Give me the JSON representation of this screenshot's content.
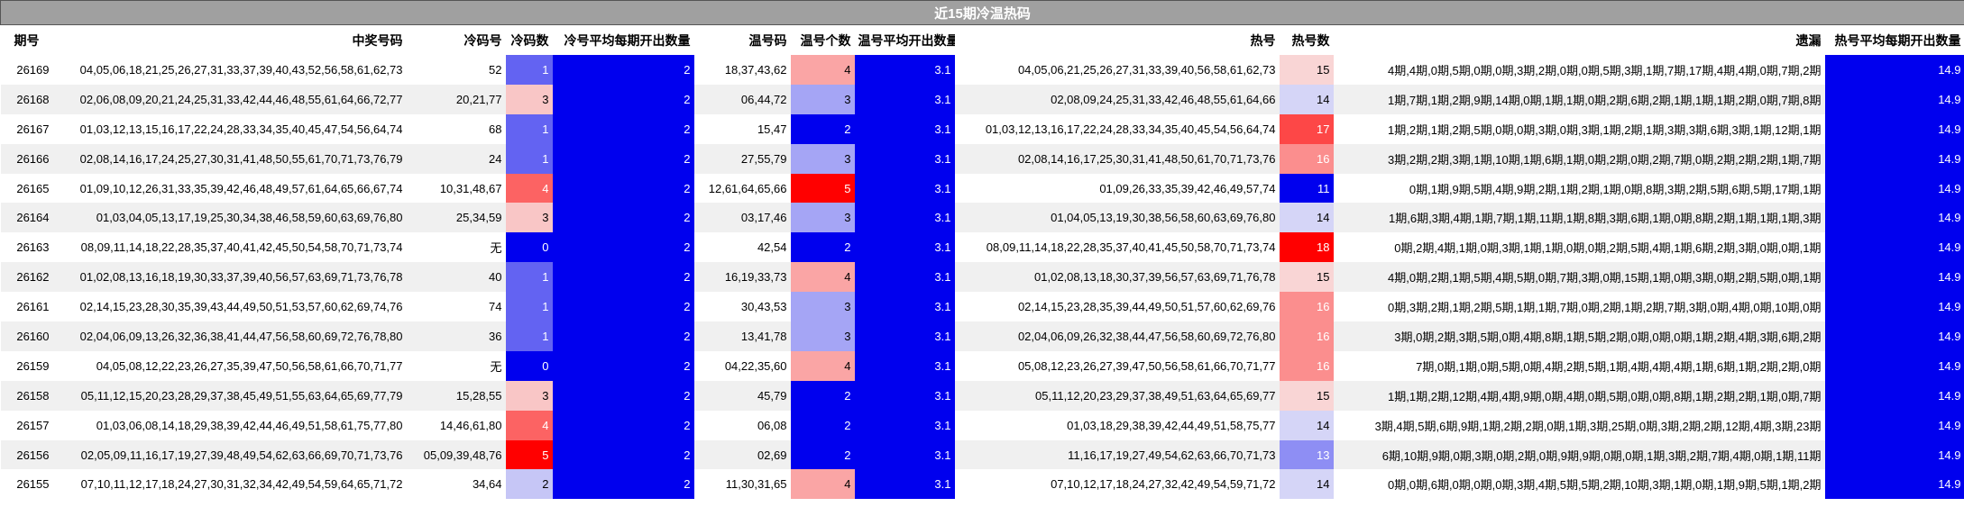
{
  "title": "近15期冷温热码",
  "columns": [
    "期号",
    "中奖号码",
    "冷码号",
    "冷码数",
    "冷号平均每期开出数量",
    "温号码",
    "温号个数",
    "温号平均开出数量",
    "热号",
    "热号数",
    "遗漏",
    "热号平均每期开出数量"
  ],
  "rows": [
    {
      "period": "26169",
      "numbers": "04,05,06,18,21,25,26,27,31,33,37,39,40,43,52,56,58,61,62,73",
      "cold": "52",
      "cold_count": "1",
      "cold_avg": "2",
      "warm": "18,37,43,62",
      "warm_count": "4",
      "warm_avg": "3.1",
      "hot": "04,05,06,21,25,26,27,31,33,39,40,56,58,61,62,73",
      "hot_count": "15",
      "miss": "4期,4期,0期,5期,0期,0期,3期,2期,0期,0期,5期,3期,1期,7期,17期,4期,4期,0期,7期,2期",
      "hot_avg": "14.9"
    },
    {
      "period": "26168",
      "numbers": "02,06,08,09,20,21,24,25,31,33,42,44,46,48,55,61,64,66,72,77",
      "cold": "20,21,77",
      "cold_count": "3",
      "cold_avg": "2",
      "warm": "06,44,72",
      "warm_count": "3",
      "warm_avg": "3.1",
      "hot": "02,08,09,24,25,31,33,42,46,48,55,61,64,66",
      "hot_count": "14",
      "miss": "1期,7期,1期,2期,9期,14期,0期,1期,1期,0期,2期,6期,2期,1期,1期,1期,2期,0期,7期,8期",
      "hot_avg": "14.9"
    },
    {
      "period": "26167",
      "numbers": "01,03,12,13,15,16,17,22,24,28,33,34,35,40,45,47,54,56,64,74",
      "cold": "68",
      "cold_count": "1",
      "cold_avg": "2",
      "warm": "15,47",
      "warm_count": "2",
      "warm_avg": "3.1",
      "hot": "01,03,12,13,16,17,22,24,28,33,34,35,40,45,54,56,64,74",
      "hot_count": "17",
      "miss": "1期,2期,1期,2期,5期,0期,0期,3期,0期,3期,1期,2期,1期,3期,3期,6期,3期,1期,12期,1期",
      "hot_avg": "14.9"
    },
    {
      "period": "26166",
      "numbers": "02,08,14,16,17,24,25,27,30,31,41,48,50,55,61,70,71,73,76,79",
      "cold": "24",
      "cold_count": "1",
      "cold_avg": "2",
      "warm": "27,55,79",
      "warm_count": "3",
      "warm_avg": "3.1",
      "hot": "02,08,14,16,17,25,30,31,41,48,50,61,70,71,73,76",
      "hot_count": "16",
      "miss": "3期,2期,2期,3期,1期,10期,1期,6期,1期,0期,2期,0期,2期,7期,0期,2期,2期,2期,1期,7期",
      "hot_avg": "14.9"
    },
    {
      "period": "26165",
      "numbers": "01,09,10,12,26,31,33,35,39,42,46,48,49,57,61,64,65,66,67,74",
      "cold": "10,31,48,67",
      "cold_count": "4",
      "cold_avg": "2",
      "warm": "12,61,64,65,66",
      "warm_count": "5",
      "warm_avg": "3.1",
      "hot": "01,09,26,33,35,39,42,46,49,57,74",
      "hot_count": "11",
      "miss": "0期,1期,9期,5期,4期,9期,2期,1期,2期,1期,0期,8期,3期,2期,5期,6期,5期,17期,1期",
      "hot_avg": "14.9"
    },
    {
      "period": "26164",
      "numbers": "01,03,04,05,13,17,19,25,30,34,38,46,58,59,60,63,69,76,80",
      "cold": "25,34,59",
      "cold_count": "3",
      "cold_avg": "2",
      "warm": "03,17,46",
      "warm_count": "3",
      "warm_avg": "3.1",
      "hot": "01,04,05,13,19,30,38,56,58,60,63,69,76,80",
      "hot_count": "14",
      "miss": "1期,6期,3期,4期,1期,7期,1期,11期,1期,8期,3期,6期,1期,0期,8期,2期,1期,1期,1期,3期",
      "hot_avg": "14.9"
    },
    {
      "period": "26163",
      "numbers": "08,09,11,14,18,22,28,35,37,40,41,42,45,50,54,58,70,71,73,74",
      "cold": "无",
      "cold_count": "0",
      "cold_avg": "2",
      "warm": "42,54",
      "warm_count": "2",
      "warm_avg": "3.1",
      "hot": "08,09,11,14,18,22,28,35,37,40,41,45,50,58,70,71,73,74",
      "hot_count": "18",
      "miss": "0期,2期,4期,1期,0期,3期,1期,1期,0期,0期,2期,5期,4期,1期,6期,2期,3期,0期,0期,1期",
      "hot_avg": "14.9"
    },
    {
      "period": "26162",
      "numbers": "01,02,08,13,16,18,19,30,33,37,39,40,56,57,63,69,71,73,76,78",
      "cold": "40",
      "cold_count": "1",
      "cold_avg": "2",
      "warm": "16,19,33,73",
      "warm_count": "4",
      "warm_avg": "3.1",
      "hot": "01,02,08,13,18,30,37,39,56,57,63,69,71,76,78",
      "hot_count": "15",
      "miss": "4期,0期,2期,1期,5期,4期,5期,0期,7期,3期,0期,15期,1期,0期,3期,0期,2期,5期,0期,1期",
      "hot_avg": "14.9"
    },
    {
      "period": "26161",
      "numbers": "02,14,15,23,28,30,35,39,43,44,49,50,51,53,57,60,62,69,74,76",
      "cold": "74",
      "cold_count": "1",
      "cold_avg": "2",
      "warm": "30,43,53",
      "warm_count": "3",
      "warm_avg": "3.1",
      "hot": "02,14,15,23,28,35,39,44,49,50,51,57,60,62,69,76",
      "hot_count": "16",
      "miss": "0期,3期,2期,1期,2期,5期,1期,1期,7期,0期,2期,1期,2期,7期,3期,0期,4期,0期,10期,0期",
      "hot_avg": "14.9"
    },
    {
      "period": "26160",
      "numbers": "02,04,06,09,13,26,32,36,38,41,44,47,56,58,60,69,72,76,78,80",
      "cold": "36",
      "cold_count": "1",
      "cold_avg": "2",
      "warm": "13,41,78",
      "warm_count": "3",
      "warm_avg": "3.1",
      "hot": "02,04,06,09,26,32,38,44,47,56,58,60,69,72,76,80",
      "hot_count": "16",
      "miss": "3期,0期,2期,3期,5期,0期,4期,8期,1期,5期,2期,0期,0期,0期,1期,2期,4期,3期,6期,2期",
      "hot_avg": "14.9"
    },
    {
      "period": "26159",
      "numbers": "04,05,08,12,22,23,26,27,35,39,47,50,56,58,61,66,70,71,77",
      "cold": "无",
      "cold_count": "0",
      "cold_avg": "2",
      "warm": "04,22,35,60",
      "warm_count": "4",
      "warm_avg": "3.1",
      "hot": "05,08,12,23,26,27,39,47,50,56,58,61,66,70,71,77",
      "hot_count": "16",
      "miss": "7期,0期,1期,0期,5期,0期,4期,2期,5期,1期,4期,4期,4期,1期,6期,1期,2期,2期,0期",
      "hot_avg": "14.9"
    },
    {
      "period": "26158",
      "numbers": "05,11,12,15,20,23,28,29,37,38,45,49,51,55,63,64,65,69,77,79",
      "cold": "15,28,55",
      "cold_count": "3",
      "cold_avg": "2",
      "warm": "45,79",
      "warm_count": "2",
      "warm_avg": "3.1",
      "hot": "05,11,12,20,23,29,37,38,49,51,63,64,65,69,77",
      "hot_count": "15",
      "miss": "1期,1期,2期,12期,4期,4期,9期,0期,4期,0期,5期,0期,0期,8期,1期,2期,2期,1期,0期,7期",
      "hot_avg": "14.9"
    },
    {
      "period": "26157",
      "numbers": "01,03,06,08,14,18,29,38,39,42,44,46,49,51,58,61,75,77,80",
      "cold": "14,46,61,80",
      "cold_count": "4",
      "cold_avg": "2",
      "warm": "06,08",
      "warm_count": "2",
      "warm_avg": "3.1",
      "hot": "01,03,18,29,38,39,42,44,49,51,58,75,77",
      "hot_count": "14",
      "miss": "3期,4期,5期,6期,9期,1期,2期,2期,0期,1期,3期,25期,0期,3期,2期,2期,12期,4期,3期,23期",
      "hot_avg": "14.9"
    },
    {
      "period": "26156",
      "numbers": "02,05,09,11,16,17,19,27,39,48,49,54,62,63,66,69,70,71,73,76",
      "cold": "05,09,39,48,76",
      "cold_count": "5",
      "cold_avg": "2",
      "warm": "02,69",
      "warm_count": "2",
      "warm_avg": "3.1",
      "hot": "11,16,17,19,27,49,54,62,63,66,70,71,73",
      "hot_count": "13",
      "miss": "6期,10期,9期,0期,3期,0期,2期,0期,9期,9期,0期,0期,1期,3期,2期,7期,4期,0期,1期,11期",
      "hot_avg": "14.9"
    },
    {
      "period": "26155",
      "numbers": "07,10,11,12,17,18,24,27,30,31,32,34,42,49,54,59,64,65,71,72",
      "cold": "34,64",
      "cold_count": "2",
      "cold_avg": "2",
      "warm": "11,30,31,65",
      "warm_count": "4",
      "warm_avg": "3.1",
      "hot": "07,10,12,17,18,24,27,32,42,49,54,59,71,72",
      "hot_count": "14",
      "miss": "0期,0期,6期,0期,0期,0期,3期,4期,5期,5期,2期,10期,3期,1期,0期,1期,9期,5期,1期,2期",
      "hot_avg": "14.9"
    }
  ]
}
